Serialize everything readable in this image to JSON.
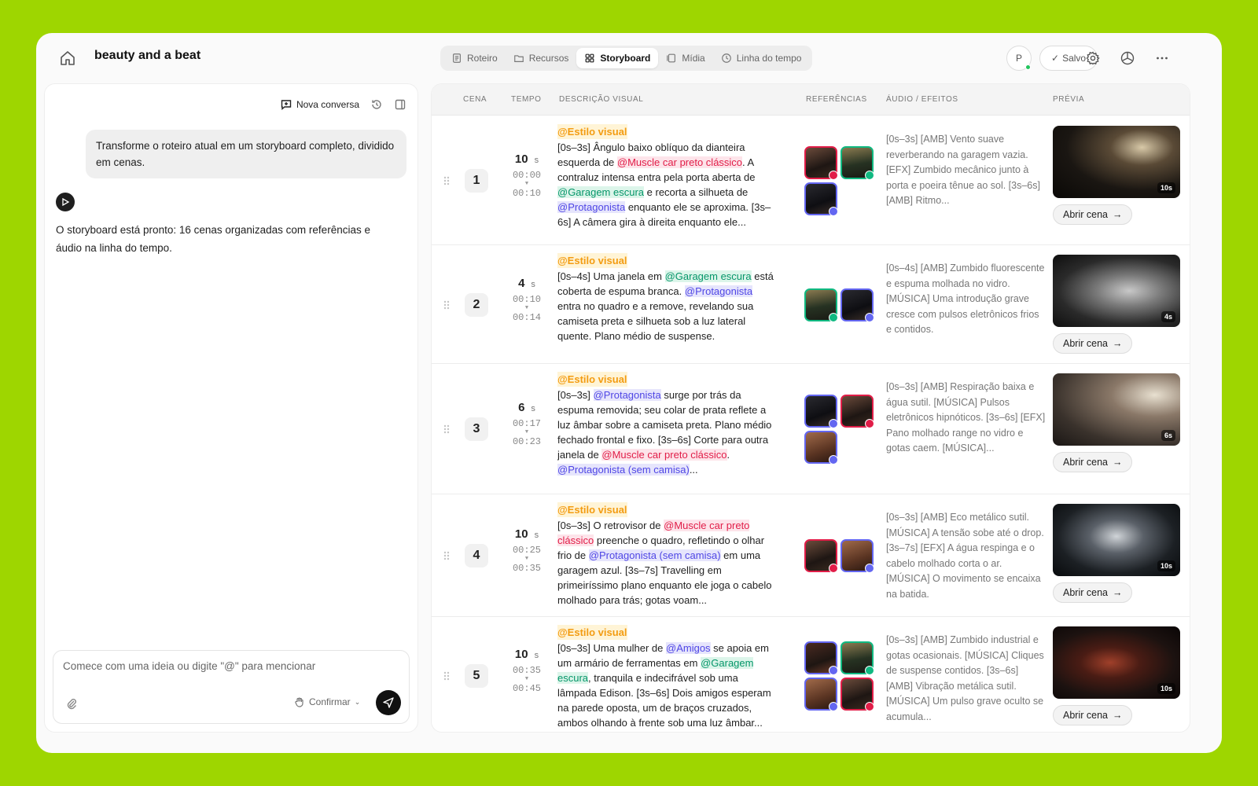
{
  "header": {
    "project_title": "beauty and a beat",
    "tabs": [
      {
        "label": "Roteiro",
        "icon": "script-icon"
      },
      {
        "label": "Recursos",
        "icon": "folder-icon"
      },
      {
        "label": "Storyboard",
        "icon": "grid-icon",
        "active": true
      },
      {
        "label": "Mídia",
        "icon": "media-icon"
      },
      {
        "label": "Linha do tempo",
        "icon": "clock-icon"
      }
    ],
    "avatar_initial": "P",
    "saved_label": "Salvo",
    "accent_online": "#22c55e"
  },
  "chat": {
    "new_conversation_label": "Nova conversa",
    "user_message": "Transforme o roteiro atual em um storyboard completo, dividido em cenas.",
    "bot_message": "O storyboard está pronto: 16 cenas organizadas com referências e áudio na linha do tempo.",
    "composer_placeholder": "Comece com uma ideia ou digite \"@\" para mencionar",
    "confirm_label": "Confirmar"
  },
  "table": {
    "headers": {
      "scene": "CENA",
      "time": "TEMPO",
      "description": "DESCRIÇÃO VISUAL",
      "references": "REFERÊNCIAS",
      "audio": "ÁUDIO / EFEITOS",
      "preview": "PRÉVIA"
    },
    "style_tag": "@Estilo visual",
    "open_scene_label": "Abrir cena",
    "rows": [
      {
        "num": "1",
        "seconds": "10",
        "unit": "s",
        "start": "00:00",
        "end": "00:10",
        "desc": [
          {
            "t": "[0s–3s] Ângulo baixo oblíquo da dianteira esquerda de "
          },
          {
            "t": "@Muscle car preto clássico",
            "m": "red"
          },
          {
            "t": ". A contraluz intensa entra pela porta aberta de "
          },
          {
            "t": "@Garagem escura",
            "m": "green"
          },
          {
            "t": " e recorta a silhueta de "
          },
          {
            "t": "@Protagonista",
            "m": "blue"
          },
          {
            "t": " enquanto ele se aproxima. [3s–6s] A câmera gira à direita enquanto ele..."
          }
        ],
        "refs": [
          "car",
          "garage",
          "hero"
        ],
        "audio": "[0s–3s] [AMB] Vento suave reverberando na garagem vazia. [EFX] Zumbido mecânico junto à porta e poeira tênue ao sol. [3s–6s] [AMB] Ritmo...",
        "preview_duration": "10s"
      },
      {
        "num": "2",
        "seconds": "4",
        "unit": "s",
        "start": "00:10",
        "end": "00:14",
        "desc": [
          {
            "t": "[0s–4s] Uma janela em "
          },
          {
            "t": "@Garagem escura",
            "m": "green"
          },
          {
            "t": " está coberta de espuma branca. "
          },
          {
            "t": "@Protagonista",
            "m": "blue"
          },
          {
            "t": " entra no quadro e a remove, revelando sua camiseta preta e silhueta sob a luz lateral quente. Plano médio de suspense."
          }
        ],
        "refs": [
          "garage",
          "hero"
        ],
        "audio": "[0s–4s] [AMB] Zumbido fluorescente e espuma molhada no vidro. [MÚSICA] Uma introdução grave cresce com pulsos eletrônicos frios e contidos.",
        "preview_duration": "4s"
      },
      {
        "num": "3",
        "seconds": "6",
        "unit": "s",
        "start": "00:17",
        "end": "00:23",
        "desc": [
          {
            "t": "[0s–3s] "
          },
          {
            "t": "@Protagonista",
            "m": "blue"
          },
          {
            "t": " surge por trás da espuma removida; seu colar de prata reflete a luz âmbar sobre a camiseta preta. Plano médio fechado frontal e fixo. [3s–6s] Corte para outra janela de "
          },
          {
            "t": "@Muscle car preto clássico",
            "m": "red"
          },
          {
            "t": ". "
          },
          {
            "t": "@Protagonista (sem camisa)",
            "m": "blue"
          },
          {
            "t": "..."
          }
        ],
        "refs": [
          "hero",
          "car",
          "skin"
        ],
        "audio": "[0s–3s] [AMB] Respiração baixa e água sutil. [MÚSICA] Pulsos eletrônicos hipnóticos. [3s–6s] [EFX] Pano molhado range no vidro e gotas caem. [MÚSICA]...",
        "preview_duration": "6s"
      },
      {
        "num": "4",
        "seconds": "10",
        "unit": "s",
        "start": "00:25",
        "end": "00:35",
        "desc": [
          {
            "t": "[0s–3s] O retrovisor de "
          },
          {
            "t": "@Muscle car preto clássico",
            "m": "red"
          },
          {
            "t": " preenche o quadro, refletindo o olhar frio de "
          },
          {
            "t": "@Protagonista (sem camisa)",
            "m": "blue"
          },
          {
            "t": " em uma garagem azul. [3s–7s] Travelling em primeiríssimo plano enquanto ele joga o cabelo molhado para trás; gotas voam..."
          }
        ],
        "refs": [
          "car",
          "skin"
        ],
        "audio": "[0s–3s] [AMB] Eco metálico sutil. [MÚSICA] A tensão sobe até o drop. [3s–7s] [EFX] A água respinga e o cabelo molhado corta o ar. [MÚSICA] O movimento se encaixa na batida.",
        "preview_duration": "10s"
      },
      {
        "num": "5",
        "seconds": "10",
        "unit": "s",
        "start": "00:35",
        "end": "00:45",
        "desc": [
          {
            "t": "[0s–3s] Uma mulher de "
          },
          {
            "t": "@Amigos",
            "m": "blue"
          },
          {
            "t": " se apoia em um armário de ferramentas em "
          },
          {
            "t": "@Garagem escura",
            "m": "green"
          },
          {
            "t": ", tranquila e indecifrável sob uma lâmpada Edison. [3s–6s] Dois amigos esperam na parede oposta, um de braços cruzados, ambos olhando à frente sob uma luz âmbar..."
          }
        ],
        "refs": [
          "friends",
          "garage",
          "skin",
          "car"
        ],
        "audio": "[0s–3s] [AMB] Zumbido industrial e gotas ocasionais. [MÚSICA] Cliques de suspense contidos. [3s–6s] [AMB] Vibração metálica sutil. [MÚSICA] Um pulso grave oculto se acumula...",
        "preview_duration": "10s"
      }
    ]
  }
}
